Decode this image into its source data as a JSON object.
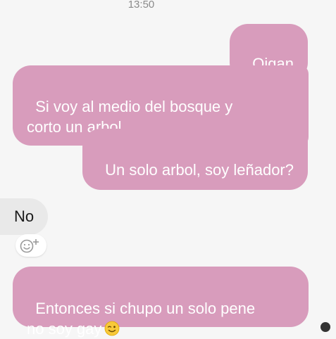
{
  "header": {
    "time": "13:50"
  },
  "messages": [
    {
      "text": "Oigan"
    },
    {
      "text": "Si voy al medio del bosque y\ncorto un arbol"
    },
    {
      "text": "Un solo arbol, soy leñador?"
    },
    {
      "text": "No"
    },
    {
      "text": "Entonces si chupo un solo pene\nno soy gay"
    }
  ],
  "icons": {
    "reaction": "add-reaction-icon",
    "wink_emoji": "wink-emoji"
  },
  "colors": {
    "outgoing_bubble": "#d89cbc",
    "incoming_bubble": "#e9e9e9",
    "background": "#f6f6f6",
    "timestamp": "#8a8a8a"
  }
}
